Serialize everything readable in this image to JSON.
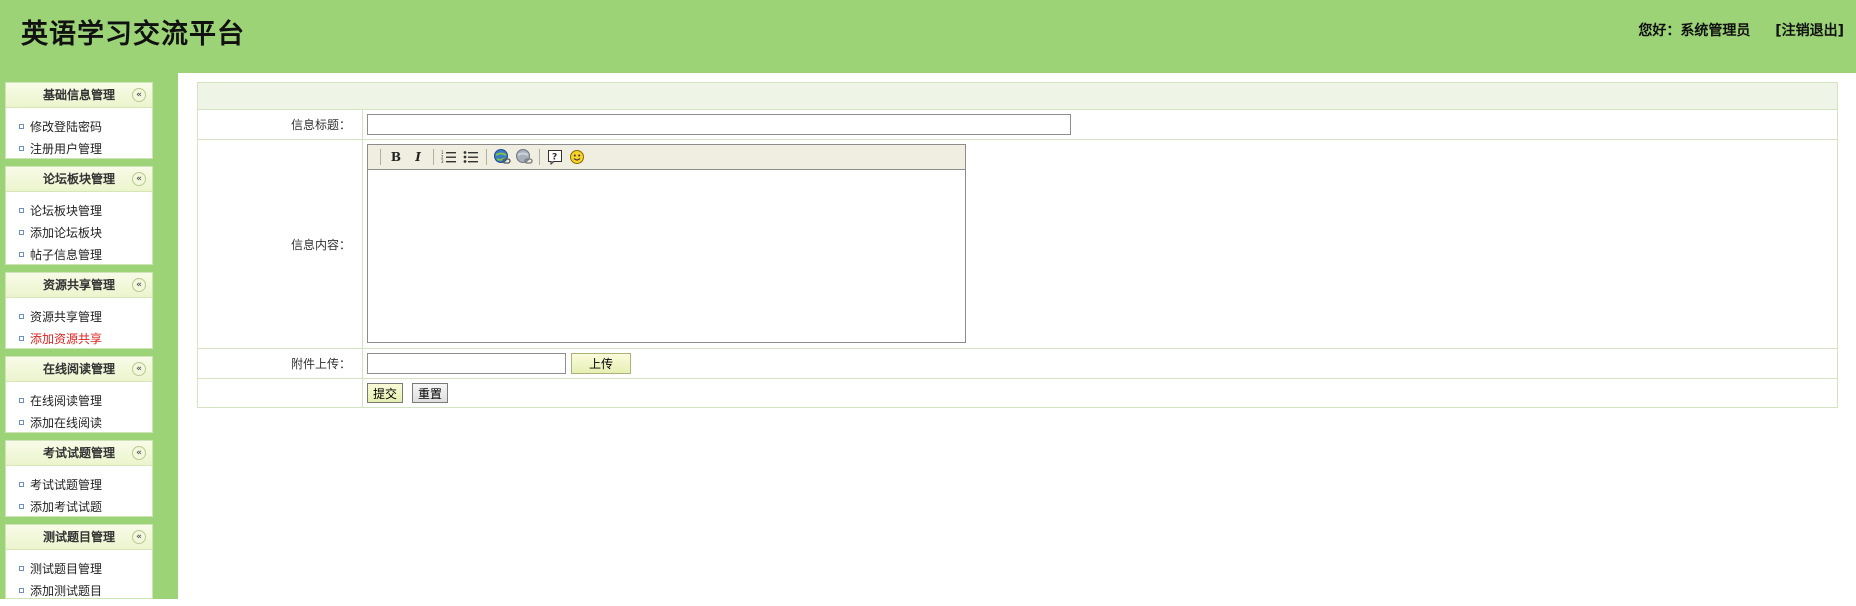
{
  "header": {
    "app_title": "英语学习交流平台",
    "greeting": "您好：系统管理员",
    "logout": "[注销退出]"
  },
  "sidebar": {
    "groups": [
      {
        "title": "基础信息管理",
        "items": [
          "修改登陆密码",
          "注册用户管理"
        ]
      },
      {
        "title": "论坛板块管理",
        "items": [
          "论坛板块管理",
          "添加论坛板块",
          "帖子信息管理"
        ]
      },
      {
        "title": "资源共享管理",
        "items": [
          "资源共享管理",
          "添加资源共享"
        ]
      },
      {
        "title": "在线阅读管理",
        "items": [
          "在线阅读管理",
          "添加在线阅读"
        ]
      },
      {
        "title": "考试试题管理",
        "items": [
          "考试试题管理",
          "添加考试试题"
        ]
      },
      {
        "title": "测试题目管理",
        "items": [
          "测试题目管理",
          "添加测试题目"
        ]
      }
    ],
    "active_item": "添加资源共享",
    "collapse_glyph": "«"
  },
  "form": {
    "title_label": "信息标题：",
    "title_value": "",
    "content_label": "信息内容：",
    "content_value": "",
    "attachment_label": "附件上传：",
    "upload_button": "上传",
    "submit_button": "提交",
    "reset_button": "重置"
  },
  "editor_toolbar": {
    "bold": "B",
    "italic": "I",
    "icons": [
      "bold-icon",
      "italic-icon",
      "ordered-list-icon",
      "unordered-list-icon",
      "insert-link-icon",
      "remove-link-icon",
      "help-icon",
      "emoticon-icon"
    ]
  },
  "colors": {
    "header_bg": "#9cd377",
    "active_menu": "#e02020"
  }
}
